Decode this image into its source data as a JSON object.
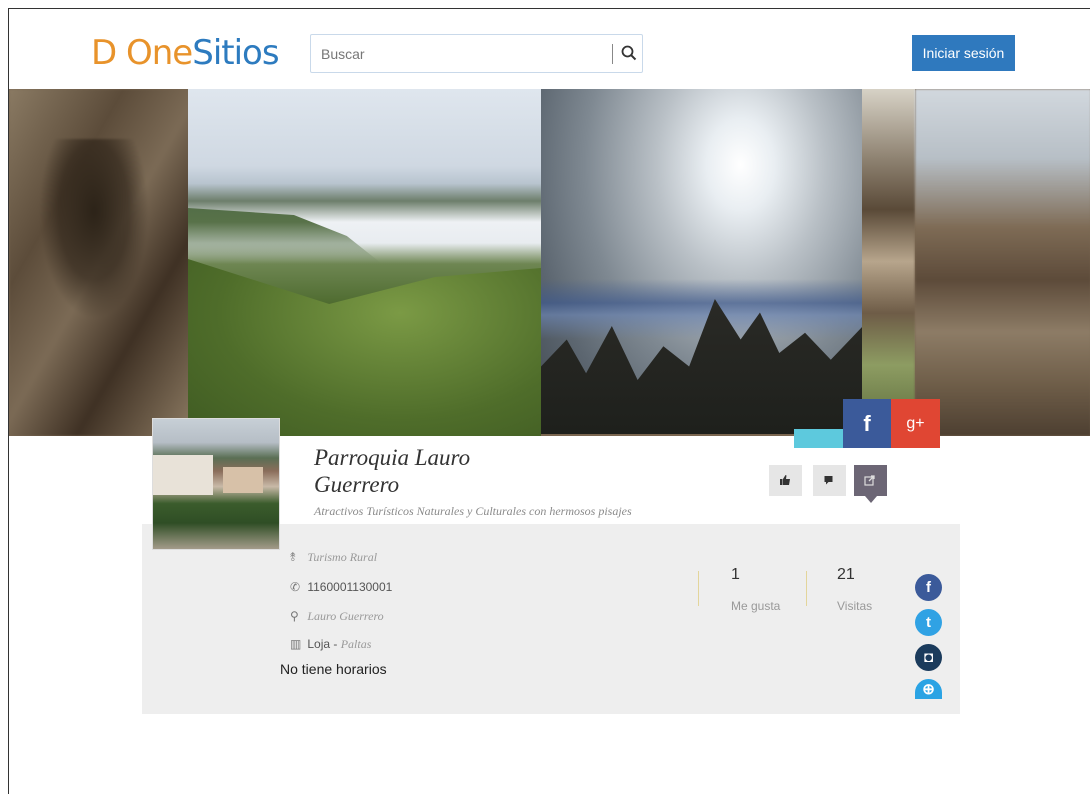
{
  "header": {
    "logo_d": "D",
    "logo_one": " One",
    "logo_sitios": "Sitios",
    "search_placeholder": "Buscar",
    "login_label": "Iniciar sesión"
  },
  "site": {
    "title": "Parroquia Lauro Guerrero",
    "subtitle": "Atractivos Turísticos  Naturales y  Culturales con hermosos pisajes",
    "category": "Turismo Rural",
    "phone": "1160001130001",
    "location": "Lauro Guerrero",
    "city": "Loja",
    "city_sep": " - ",
    "canton": "Paltas",
    "hours": "No tiene horarios"
  },
  "stats": {
    "likes_value": "1",
    "likes_label": "Me gusta",
    "visits_value": "21",
    "visits_label": "Visitas"
  },
  "share": {
    "facebook_glyph": "f",
    "gplus_glyph": "g+"
  },
  "social": {
    "facebook_glyph": "f",
    "twitter_glyph": "t",
    "instagram_glyph": "◘",
    "web_glyph": "⊕"
  },
  "colors": {
    "accent_blue": "#2f79be",
    "logo_orange": "#e8932b",
    "facebook": "#3b5a9a",
    "gplus": "#e04633",
    "twitter": "#30a2e4"
  }
}
